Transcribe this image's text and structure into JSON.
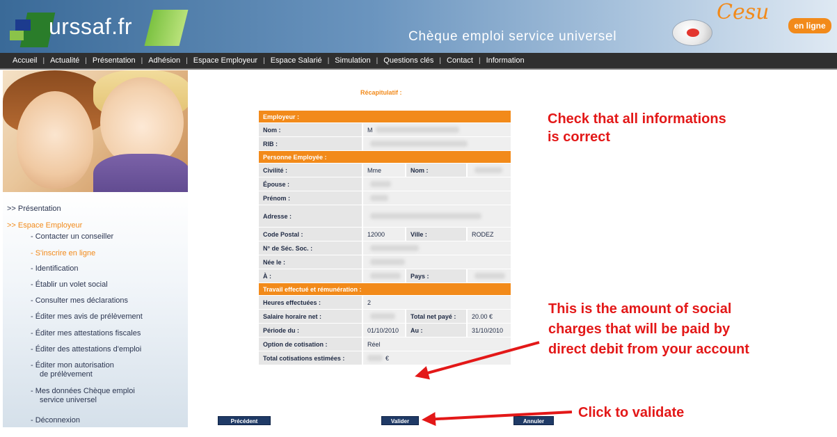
{
  "header": {
    "logo_text": "urssaf.fr",
    "subtitle": "Chèque emploi service universel",
    "cesu_logo": "Cesu",
    "en_ligne": "en ligne"
  },
  "nav": [
    "Accueil",
    "Actualité",
    "Présentation",
    "Adhésion",
    "Espace Employeur",
    "Espace Salarié",
    "Simulation",
    "Questions clés",
    "Contact",
    "Information"
  ],
  "sidebar": {
    "presentation": ">> Présentation",
    "espace_employeur": ">> Espace Employeur",
    "items": [
      "- Contacter un conseiller",
      "- S'inscrire en ligne",
      "- Identification",
      "- Établir un volet social",
      "- Consulter mes déclarations",
      "- Éditer mes avis de prélèvement",
      "- Éditer mes attestations fiscales",
      "- Éditer des attestations d'emploi",
      "- Éditer mon autorisation",
      "de prélèvement",
      "- Mes données Chèque emploi",
      "service universel",
      "- Déconnexion"
    ]
  },
  "recap": {
    "title": "Récapitulatif :",
    "section_employeur": "Employeur :",
    "nom_label": "Nom :",
    "nom_value": "M",
    "rib_label": "RIB :",
    "section_employe": "Personne Employée :",
    "civilite_label": "Civilité :",
    "civilite_value": "Mme",
    "nom2_label": "Nom :",
    "epouse_label": "Épouse :",
    "prenom_label": "Prénom :",
    "adresse_label": "Adresse :",
    "cp_label": "Code Postal :",
    "cp_value": "12000",
    "ville_label": "Ville :",
    "ville_value": "RODEZ",
    "secu_label": "N° de Séc. Soc. :",
    "nee_label": "Née le :",
    "a_label": "À :",
    "pays_label": "Pays :",
    "section_travail": "Travail effectué et rémunération :",
    "heures_label": "Heures effectuées :",
    "heures_value": "2",
    "salaire_label": "Salaire horaire net :",
    "total_net_label": "Total net payé :",
    "total_net_value": "20.00 €",
    "periode_label": "Période du :",
    "periode_from": "01/10/2010",
    "au_label": "Au :",
    "periode_to": "31/10/2010",
    "option_label": "Option de cotisation :",
    "option_value": "Réel",
    "total_cot_label": "Total cotisations estimées :",
    "total_cot_value": "€"
  },
  "buttons": {
    "precedent": "Précédent",
    "valider": "Valider",
    "annuler": "Annuler"
  },
  "annotations": {
    "check_line1": "Check that all informations",
    "check_line2": "is correct",
    "amount_line1": "This is the amount of social",
    "amount_line2": "charges that will be paid by",
    "amount_line3": "direct debit from your account",
    "click": "Click to validate"
  },
  "colors": {
    "accent_orange": "#f28a1a",
    "annotation_red": "#e31818",
    "button_navy": "#1f3a66"
  }
}
